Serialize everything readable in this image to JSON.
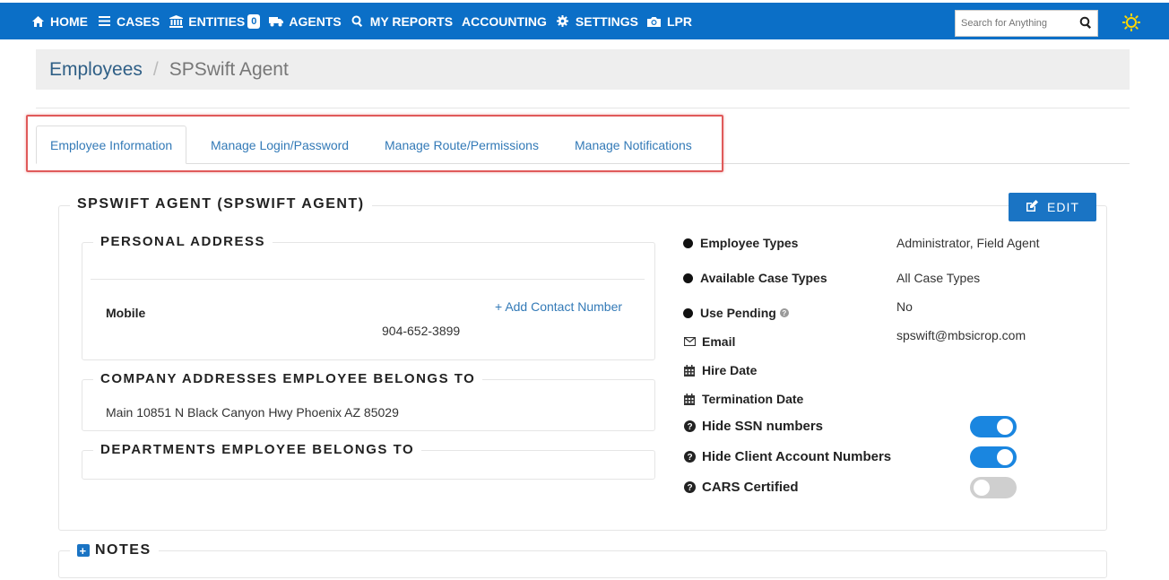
{
  "nav": {
    "items": [
      {
        "label": "HOME",
        "icon": "home-icon"
      },
      {
        "label": "CASES",
        "icon": "list-icon"
      },
      {
        "label": "ENTITIES",
        "icon": "bank-icon",
        "badge": "0"
      },
      {
        "label": "AGENTS",
        "icon": "truck-icon"
      },
      {
        "label": "MY REPORTS",
        "icon": "search-icon"
      },
      {
        "label": "ACCOUNTING",
        "icon": ""
      },
      {
        "label": "SETTINGS",
        "icon": "gear-icon"
      },
      {
        "label": "LPR",
        "icon": "camera-icon"
      }
    ],
    "search_placeholder": "Search for Anything"
  },
  "breadcrumb": {
    "parent": "Employees",
    "separator": "/",
    "current": "SPSwift Agent"
  },
  "tabs": [
    {
      "label": "Employee Information",
      "active": true
    },
    {
      "label": "Manage Login/Password",
      "active": false
    },
    {
      "label": "Manage Route/Permissions",
      "active": false
    },
    {
      "label": "Manage Notifications",
      "active": false
    }
  ],
  "employee": {
    "title": "SPSWIFT AGENT (SPSWIFT AGENT)",
    "edit_label": "EDIT",
    "personal_address_title": "PERSONAL ADDRESS",
    "add_contact_label": "Add Contact Number",
    "mobile_label": "Mobile",
    "mobile_number": "904-652-3899",
    "company_title": "COMPANY ADDRESSES EMPLOYEE BELONGS TO",
    "company_address": "Main 10851 N Black Canyon Hwy Phoenix AZ 85029",
    "departments_title": "DEPARTMENTS EMPLOYEE BELONGS TO"
  },
  "details": {
    "employee_types_label": "Employee Types",
    "employee_types_value": "Administrator, Field Agent",
    "case_types_label": "Available Case Types",
    "case_types_value": "All Case Types",
    "use_pending_label": "Use Pending",
    "use_pending_value": "No",
    "email_label": "Email",
    "email_value": "spswift@mbsicrop.com",
    "hire_date_label": "Hire Date",
    "termination_date_label": "Termination Date",
    "hide_ssn_label": "Hide SSN numbers",
    "hide_ssn_on": true,
    "hide_client_label": "Hide Client Account Numbers",
    "hide_client_on": true,
    "cars_label": "CARS Certified",
    "cars_on": false
  },
  "notes": {
    "title": "NOTES"
  },
  "colors": {
    "navbar": "#0b6fc7",
    "link": "#337ab7",
    "toggle_on": "#1a86e0",
    "highlight": "#e05a5a"
  }
}
